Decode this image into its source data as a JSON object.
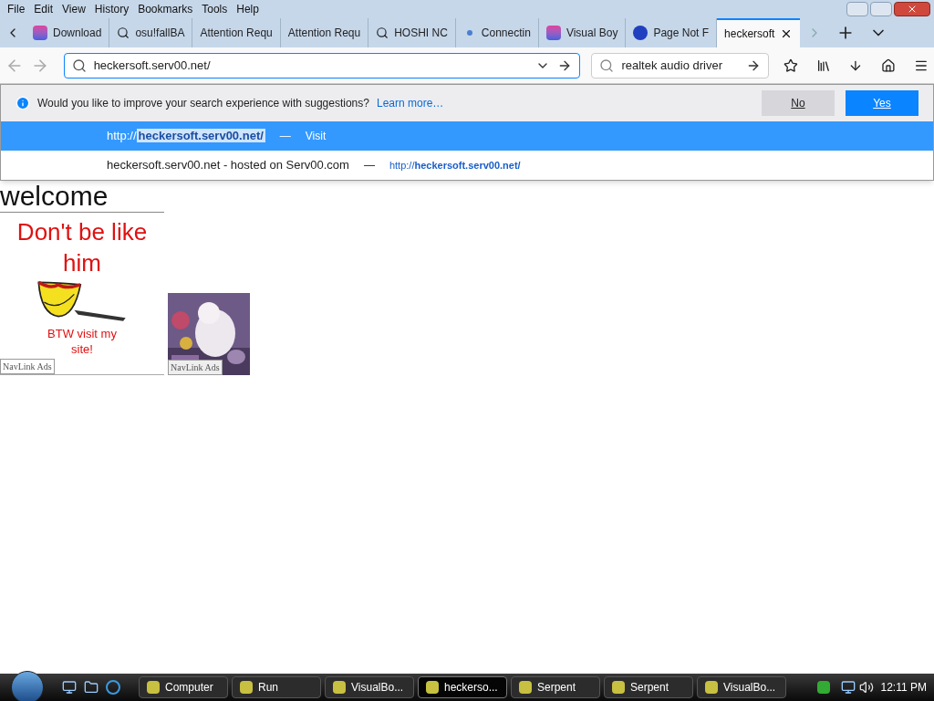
{
  "menu": [
    "File",
    "Edit",
    "View",
    "History",
    "Bookmarks",
    "Tools",
    "Help"
  ],
  "tabs": [
    {
      "label": "Download",
      "kind": "app",
      "selected": false
    },
    {
      "label": "osu!fallBA",
      "kind": "search",
      "selected": false
    },
    {
      "label": "Attention Requ",
      "kind": "plain",
      "selected": false
    },
    {
      "label": "Attention Requ",
      "kind": "plain",
      "selected": false
    },
    {
      "label": "HOSHI NC",
      "kind": "search",
      "selected": false
    },
    {
      "label": "Connectin",
      "kind": "loading",
      "selected": false
    },
    {
      "label": "Visual Boy",
      "kind": "app",
      "selected": false
    },
    {
      "label": "Page Not F",
      "kind": "globe",
      "selected": false
    },
    {
      "label": "heckersoft",
      "kind": "plain",
      "selected": true
    }
  ],
  "address": {
    "value": "heckersoft.serv00.net/"
  },
  "search": {
    "value": "realtek audio driver"
  },
  "notice": {
    "text": "Would you like to improve your search experience with suggestions?",
    "link": "Learn more…",
    "buttons": [
      {
        "label": "No",
        "primary": false
      },
      {
        "label": "Yes",
        "primary": true
      }
    ]
  },
  "suggestions": [
    {
      "prefix": "http://",
      "highlight": "heckersoft.serv00.net/",
      "sep": "—",
      "action": "Visit",
      "selected": true
    },
    {
      "title": "heckersoft.serv00.net - hosted on Serv00.com",
      "sep": "—",
      "url": "http://**heckersoft.serv00.net/**",
      "selected": false
    }
  ],
  "page": {
    "heading": "welcome",
    "ads": [
      {
        "kind": "drawing",
        "headline": "Don't be like him",
        "caption": "BTW visit my site!",
        "label": "NavLink Ads"
      },
      {
        "kind": "picture",
        "label": "NavLink Ads"
      }
    ]
  },
  "taskbar": {
    "items": [
      {
        "label": "Computer",
        "active": false
      },
      {
        "label": "Run",
        "active": false
      },
      {
        "label": "VisualBo...",
        "active": false
      },
      {
        "label": "heckerso...",
        "active": true
      },
      {
        "label": "Serpent",
        "active": false
      },
      {
        "label": "Serpent",
        "active": false
      },
      {
        "label": "VisualBo...",
        "active": false
      }
    ],
    "clock": "12:11 PM"
  }
}
